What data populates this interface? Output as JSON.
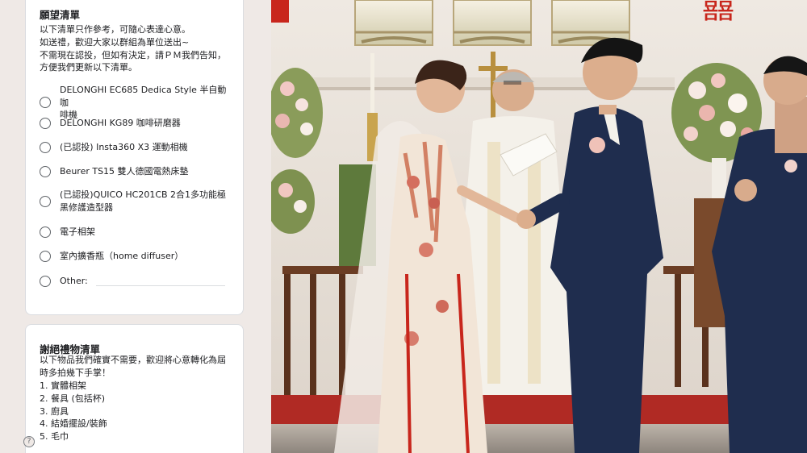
{
  "wishlist": {
    "title": "願望清單",
    "desc": [
      "以下清單只作參考，可隨心表達心意。",
      "如送禮，歡迎大家以群組為單位送出~",
      "不需現在認投，但如有決定，請ＰＭ我們告知，",
      "方便我們更新以下清單。"
    ],
    "options": [
      [
        "DELONGHI EC685 Dedica Style 半自動咖",
        "啡機"
      ],
      [
        "DELONGHI KG89 咖啡研磨器"
      ],
      [
        "(已認投) Insta360 X3 運動相機"
      ],
      [
        "Beurer TS15 雙人德國電熱床墊"
      ],
      [
        "(已認投)QUICO HC201CB 2合1多功能極",
        "黑修護造型器"
      ],
      [
        "電子相架"
      ],
      [
        "室內擴香瓶（home diffuser）"
      ],
      [
        "Other:"
      ]
    ]
  },
  "decline": {
    "title": "謝絕禮物清單",
    "desc": [
      "以下物品我們確實不需要，歡迎將心意轉化為屆",
      "時多拍幾下手掌！"
    ],
    "items": [
      "1. 實體相架",
      "2. 餐具 (包括杯)",
      "3. 廚具",
      "4. 結婚擺設/裝飾",
      "5. 毛巾"
    ]
  },
  "help_icon": {
    "name": "help-icon",
    "glyph": "?"
  },
  "photo": {
    "description_icon": "wedding-photo",
    "banner_text": "囍"
  }
}
